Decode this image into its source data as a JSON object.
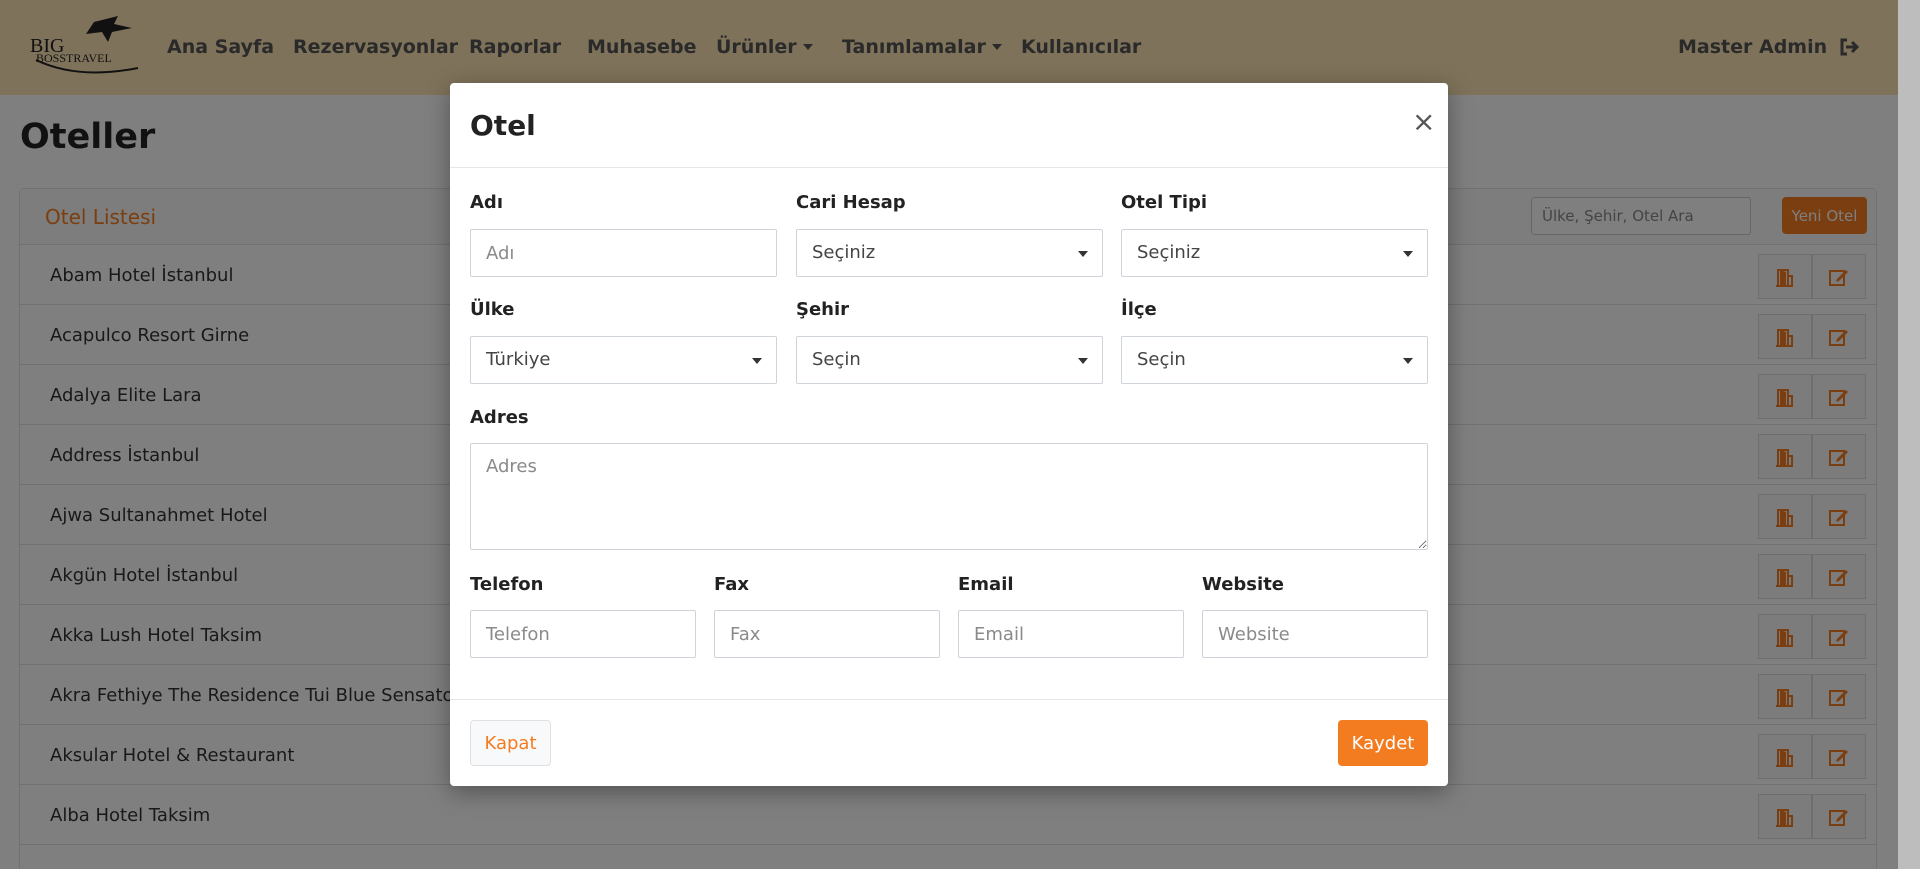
{
  "app": {
    "logo_text": "BIG BOSS TRAVEL",
    "logo_text_lines": [
      "BIG",
      "BOSSTRAVEL"
    ]
  },
  "nav": {
    "items": [
      {
        "label": "Ana Sayfa",
        "dropdown": false
      },
      {
        "label": "Rezervasyonlar",
        "dropdown": false
      },
      {
        "label": "Raporlar",
        "dropdown": false
      },
      {
        "label": "Muhasebe",
        "dropdown": false
      },
      {
        "label": "Ürünler",
        "dropdown": true
      },
      {
        "label": "Tanımlamalar",
        "dropdown": true
      },
      {
        "label": "Kullanıcılar",
        "dropdown": false
      }
    ],
    "user": "Master Admin",
    "logout_icon": "sign-out-icon"
  },
  "page": {
    "title": "Oteller",
    "card_title": "Otel Listesi",
    "search_placeholder": "Ülke, Şehir, Otel Ara",
    "new_button": "Yeni Otel",
    "rows": [
      "Abam Hotel İstanbul",
      "Acapulco Resort Girne",
      "Adalya Elite Lara",
      "Address İstanbul",
      "Ajwa Sultanahmet Hotel",
      "Akgün Hotel İstanbul",
      "Akka Lush Hotel Taksim",
      "Akra Fethiye The Residence Tui Blue Sensatori",
      "Aksular Hotel & Restaurant",
      "Alba Hotel Taksim"
    ],
    "row_icons": [
      "door-open-icon",
      "edit-icon"
    ]
  },
  "modal": {
    "title": "Otel",
    "close_symbol": "×",
    "fields": {
      "name": {
        "label": "Adı",
        "placeholder": "Adı",
        "value": ""
      },
      "account": {
        "label": "Cari Hesap",
        "value": "Seçiniz"
      },
      "hotel_type": {
        "label": "Otel Tipi",
        "value": "Seçiniz"
      },
      "country": {
        "label": "Ülke",
        "value": "Türkiye"
      },
      "city": {
        "label": "Şehir",
        "value": "Seçin"
      },
      "district": {
        "label": "İlçe",
        "value": "Seçin"
      },
      "address": {
        "label": "Adres",
        "placeholder": "Adres",
        "value": ""
      },
      "phone": {
        "label": "Telefon",
        "placeholder": "Telefon",
        "value": ""
      },
      "fax": {
        "label": "Fax",
        "placeholder": "Fax",
        "value": ""
      },
      "email": {
        "label": "Email",
        "placeholder": "Email",
        "value": ""
      },
      "website": {
        "label": "Website",
        "placeholder": "Website",
        "value": ""
      }
    },
    "close_button": "Kapat",
    "save_button": "Kaydet"
  },
  "colors": {
    "accent": "#f47c20",
    "navbar": "#fde5b5",
    "backdrop": "rgba(0,0,0,0.5)"
  }
}
